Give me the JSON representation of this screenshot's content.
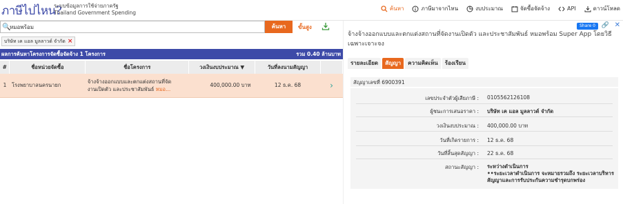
{
  "header": {
    "logo": "ภาษีไปไหน?",
    "subtitle_th": "ระบบข้อมูลการใช้จ่ายภาครัฐ",
    "subtitle_en": "Thailand Government Spending",
    "nav": [
      {
        "label": "ค้นหา",
        "icon": "search-icon",
        "active": true
      },
      {
        "label": "ภาษีมาจากไหน",
        "icon": "info-icon",
        "active": false
      },
      {
        "label": "งบประมาณ",
        "icon": "pie-chart-icon",
        "active": false
      },
      {
        "label": "จัดซื้อจัดจ้าง",
        "icon": "procurement-icon",
        "active": false
      },
      {
        "label": "API",
        "icon": "code-icon",
        "active": false
      },
      {
        "label": "ดาวน์โหลด",
        "icon": "download-icon",
        "active": false
      }
    ]
  },
  "search": {
    "value": "หมอพร้อม",
    "button_label": "ค้นหา",
    "advanced_label": "ขั้นสูง"
  },
  "filter_chip": {
    "label": "บริษัท เค แอล มูลลาวด์ จำกัด"
  },
  "results": {
    "summary": "ผลการค้นหาโครงการจัดซื้อจัดจ้าง 1 โครงการ",
    "total": "รวม 0.40 ล้านบาท",
    "columns": [
      "#",
      "ชื่อหน่วยจัดซื้อ",
      "ชื่อโครงการ",
      "วงเงินงบประมาณ",
      "วันที่ลงนามสัญญา"
    ],
    "rows": [
      {
        "no": "1",
        "agency": "โรงพยาบาลนครนายก",
        "project_line1": "จ้างจ้างออกแบบและตกแต่งสถานที่จัด",
        "project_line2": "งานเปิดตัว และประชาสัมพันธ์",
        "project_more": "หมอ...",
        "budget": "400,000.00 บาท",
        "date": "12 ธ.ค. 68"
      }
    ]
  },
  "detail": {
    "share_label": "Share 0",
    "title": "จ้างจ้างออกแบบและตกแต่งสถานที่จัดงานเปิดตัว และประชาสัมพันธ์ หมอพร้อม Super App โดยวิธีเฉพาะเจาะจง",
    "tabs": [
      {
        "label": "รายละเอียด",
        "active": false
      },
      {
        "label": "สัญญา",
        "active": true
      },
      {
        "label": "ความคิดเห็น",
        "active": false
      },
      {
        "label": "ร้องเรียน",
        "active": false
      }
    ],
    "contract_no_label": "สัญญาเลขที่",
    "contract_no": "6900391",
    "fields": [
      {
        "key": "เลขประจำตัวผู้เสียภาษี :",
        "value": "0105562126108",
        "bold": false
      },
      {
        "key": "ผู้ชนะการเสนอราคา :",
        "value": "บริษัท เค แอล มูลลาวด์ จำกัด",
        "bold": true
      },
      {
        "key": "วงเงินงบประมาณ :",
        "value": "400,000.00  บาท",
        "bold": false
      },
      {
        "key": "วันที่เกิดรายการ :",
        "value": "12 ธ.ค. 68",
        "bold": false
      },
      {
        "key": "วันที่สิ้นสุดสัญญา :",
        "value": "22 ธ.ค. 68",
        "bold": false
      }
    ],
    "status_key": "สถานะสัญญา :",
    "status_line1": "ระหว่างดำเนินการ",
    "status_line2": "••ระยะเวลาดำเนินการ จะหมายรวมถึง ระยะเวลาบริหาร",
    "status_line3": "สัญญาและการรับประกันความชำรุดบกพร่อง"
  },
  "colors": {
    "accent": "#e8681e",
    "brand": "#3d4aa8",
    "row_highlight": "#fbe0cf"
  }
}
